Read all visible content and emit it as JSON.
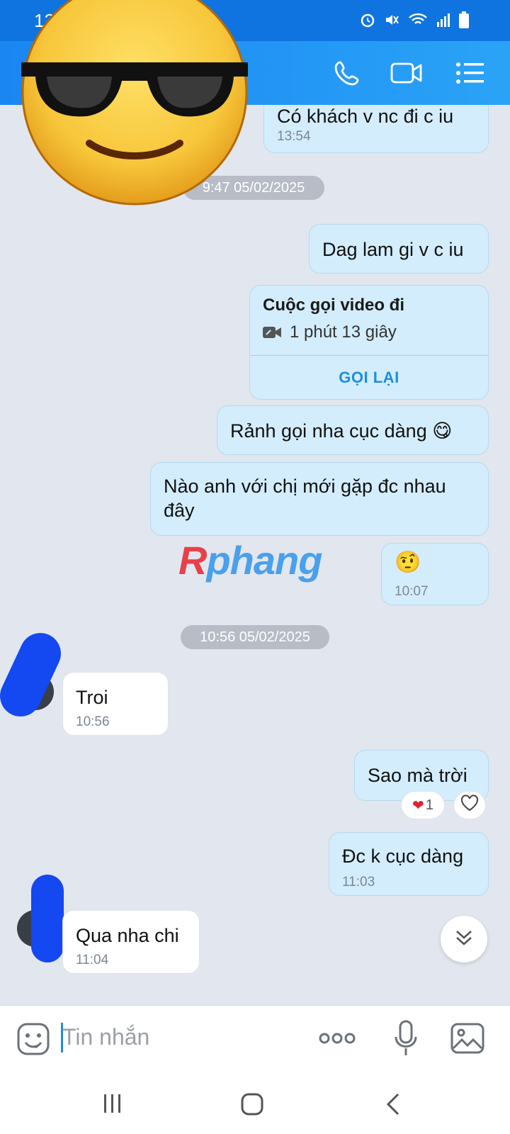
{
  "status_bar": {
    "time": "12"
  },
  "messages": {
    "m1": {
      "text": "Có khách v nc đi c iu",
      "time": "13:54"
    },
    "date1": "9:47 05/02/2025",
    "m2": {
      "text": "Dag lam gi v c iu"
    },
    "call": {
      "title": "Cuộc gọi video đi",
      "duration": "1 phút 13 giây",
      "action": "GỌI LẠI"
    },
    "m3": {
      "text": "Rảnh gọi nha cục dàng 😋"
    },
    "m4": {
      "text": "Nào anh với chị mới gặp đc nhau đây"
    },
    "m5": {
      "emoji": "🤨",
      "time": "10:07"
    },
    "date2": "10:56 05/02/2025",
    "m6": {
      "text": "Troi",
      "time": "10:56"
    },
    "m7": {
      "text": "Sao mà trời",
      "reaction_count": "1"
    },
    "m8": {
      "text": "Đc k cục dàng",
      "time": "11:03"
    },
    "m9": {
      "text": "Qua nha chi",
      "time": "11:04"
    }
  },
  "watermark": {
    "r": "R",
    "rest": "phang"
  },
  "input": {
    "placeholder": "Tin nhắn"
  },
  "icons": {
    "call": "phone-icon",
    "video": "video-icon",
    "menu": "menu-icon",
    "sticker": "sticker-icon",
    "more": "more-icon",
    "mic": "mic-icon",
    "image": "image-icon"
  },
  "colors": {
    "header": "#1a86f2",
    "outgoing_bubble": "#d4edfc",
    "incoming_bubble": "#ffffff",
    "accent": "#1a8fe0"
  }
}
